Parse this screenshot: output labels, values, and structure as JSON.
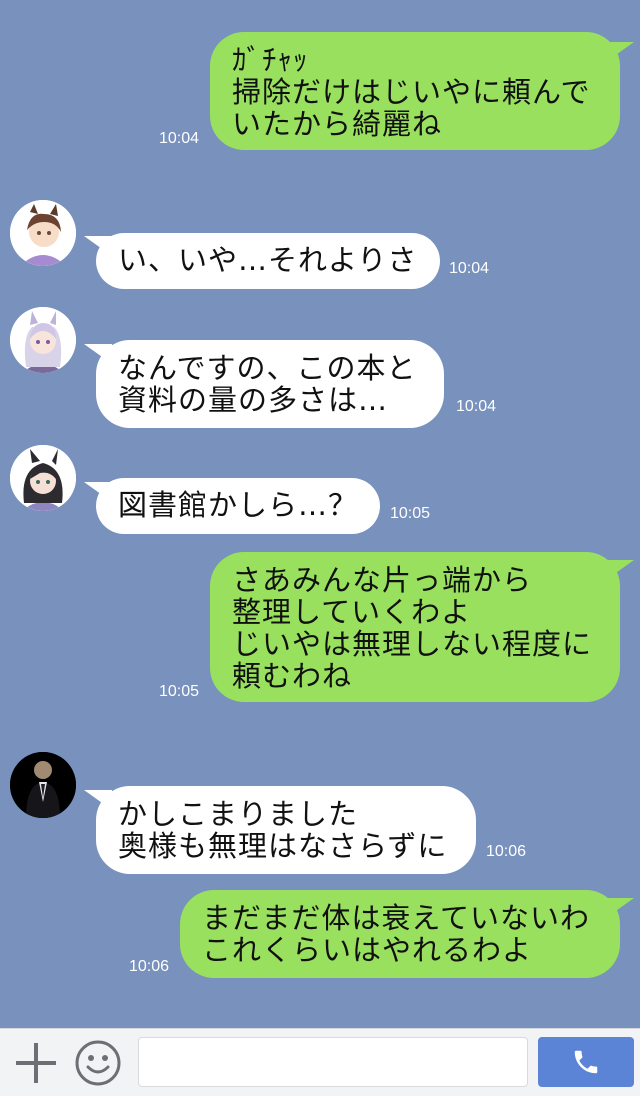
{
  "messages": [
    {
      "side": "right",
      "text": "ｶﾞﾁｬｯ\n掃除だけはじいやに頼んで\nいたから綺麗ね",
      "time": "10:04"
    },
    {
      "side": "left",
      "avatar": "girl-brown-hair-avatar",
      "text": "い、いや…それよりさ",
      "time": "10:04"
    },
    {
      "side": "left",
      "avatar": "girl-silver-hair-avatar",
      "text": "なんですの、この本と\n資料の量の多さは…",
      "time": "10:04"
    },
    {
      "side": "left",
      "avatar": "girl-black-hair-avatar",
      "text": "図書館かしら…？",
      "time": "10:05"
    },
    {
      "side": "right",
      "text": "さあみんな片っ端から\n整理していくわよ\nじいやは無理しない程度に\n頼むわね",
      "time": "10:05"
    },
    {
      "side": "left",
      "avatar": "butler-avatar",
      "text": "かしこまりました\n奥様も無理はなさらずに",
      "time": "10:06"
    },
    {
      "side": "right",
      "text": "まだまだ体は衰えていないわ\nこれくらいはやれるわよ",
      "time": "10:06"
    }
  ],
  "input": {
    "value": "",
    "placeholder": ""
  },
  "icons": {
    "add": "plus-icon",
    "sticker": "emoji-icon",
    "call": "phone-icon"
  },
  "colors": {
    "background": "#7891bd",
    "outgoing_bubble": "#98e05d",
    "incoming_bubble": "#ffffff",
    "call_button": "#5c84d6"
  }
}
